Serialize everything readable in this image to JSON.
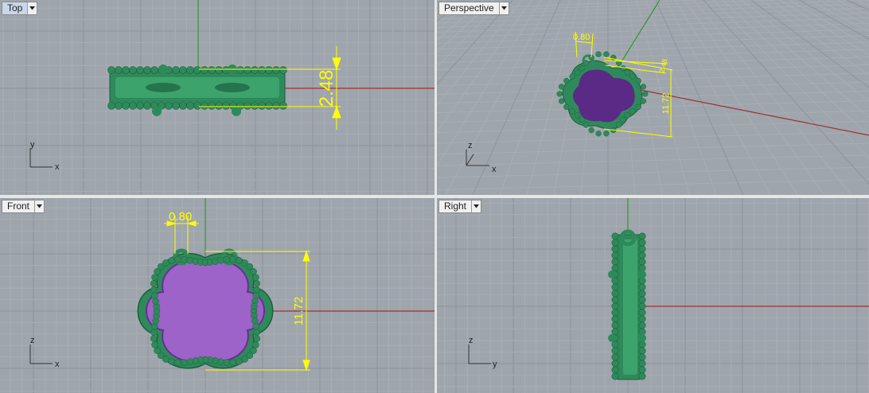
{
  "viewports": {
    "top": {
      "label": "Top",
      "active": true,
      "axis_v": "y",
      "axis_h": "x",
      "dim_width": "2.48"
    },
    "perspective": {
      "label": "Perspective",
      "active": false,
      "axis_v": "z",
      "axis_h": "x",
      "dim_width": "0.80",
      "dim_height": "11.72",
      "dim_depth": "2.48"
    },
    "front": {
      "label": "Front",
      "active": false,
      "axis_v": "z",
      "axis_h": "x",
      "dim_width": "0.80",
      "dim_height": "11.72"
    },
    "right": {
      "label": "Right",
      "active": false,
      "axis_v": "z",
      "axis_h": "y"
    }
  },
  "colors": {
    "viewport_bg": "#9fa5ac",
    "grid_minor": "#a9aeb4",
    "grid_major": "#8e949b",
    "x_axis": "#a0302c",
    "y_axis": "#2e9a2e",
    "model_green": "#2e8a5a",
    "gem_purple": "#8a4bb0",
    "dimension": "#ffff00",
    "active_label": "#c9d7ea"
  },
  "icons": {
    "viewport_menu": "dropdown-arrow-icon"
  }
}
